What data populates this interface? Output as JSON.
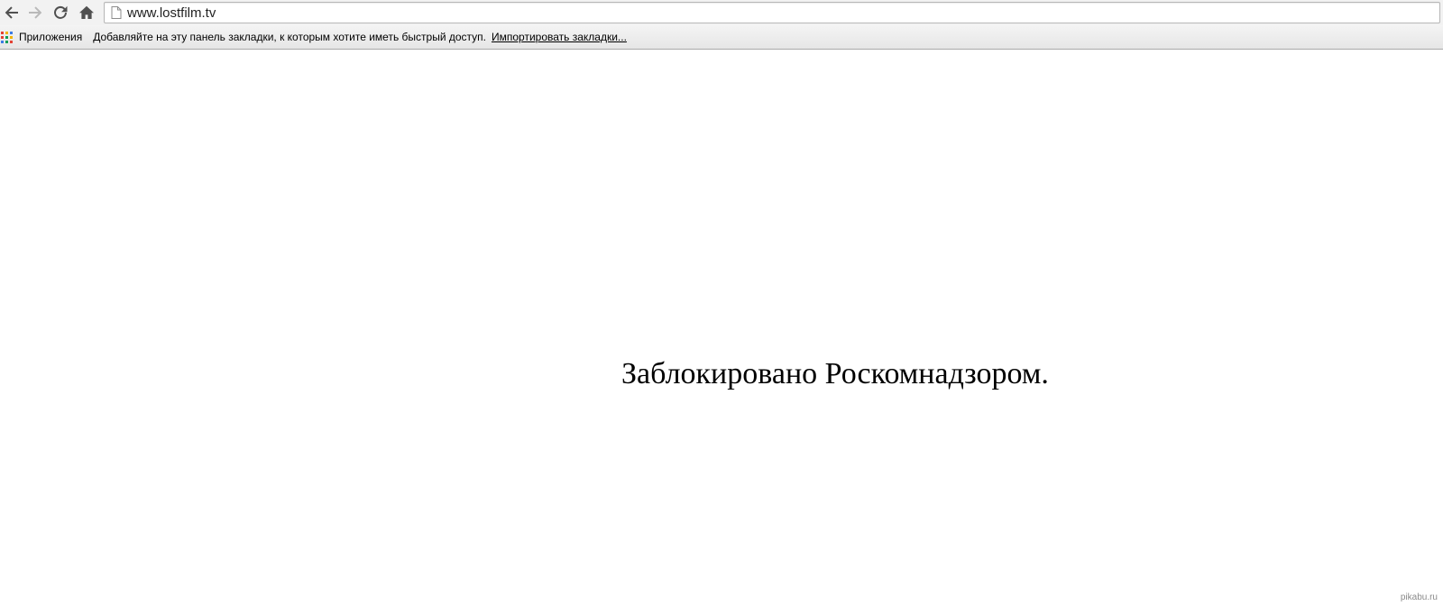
{
  "toolbar": {
    "back_icon": "arrow-left-icon",
    "forward_icon": "arrow-right-icon",
    "reload_icon": "reload-icon",
    "home_icon": "home-icon",
    "page_icon": "page-icon",
    "url": "www.lostfilm.tv"
  },
  "bookmarks_bar": {
    "apps_label": "Приложения",
    "apps_icon": "apps-grid-icon",
    "apps_colors": [
      "#e34133",
      "#f4b400",
      "#3b7be4",
      "#e34133",
      "#0f9d58",
      "#f4b400",
      "#3b7be4",
      "#0f9d58",
      "#e34133"
    ],
    "hint_text": "Добавляйте на эту панель закладки, к которым хотите иметь быстрый доступ.",
    "import_link": "Импортировать закладки..."
  },
  "content": {
    "message": "Заблокировано Роскомнадзором."
  },
  "watermark": "pikabu.ru"
}
